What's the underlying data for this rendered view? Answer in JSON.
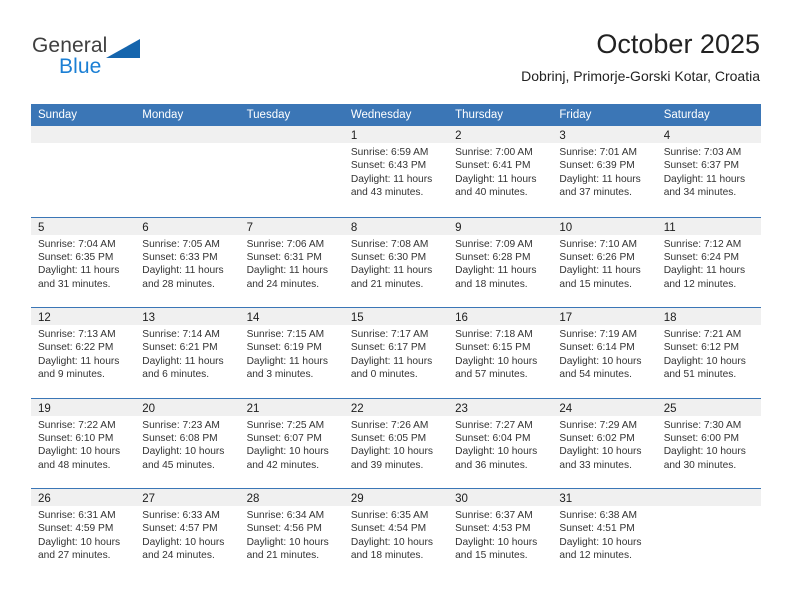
{
  "brand": {
    "name_part1": "General",
    "name_part2": "Blue",
    "accent_color": "#1b7fd4",
    "triangle_color": "#1565ad"
  },
  "header": {
    "month_title": "October 2025",
    "location": "Dobrinj, Primorje-Gorski Kotar, Croatia"
  },
  "calendar": {
    "header_color": "#3b76b6",
    "day_band_color": "#f0f0f0",
    "weekdays": [
      "Sunday",
      "Monday",
      "Tuesday",
      "Wednesday",
      "Thursday",
      "Friday",
      "Saturday"
    ],
    "weeks": [
      [
        {
          "empty": true
        },
        {
          "empty": true
        },
        {
          "empty": true
        },
        {
          "day": "1",
          "sunrise": "Sunrise: 6:59 AM",
          "sunset": "Sunset: 6:43 PM",
          "daylight1": "Daylight: 11 hours",
          "daylight2": "and 43 minutes."
        },
        {
          "day": "2",
          "sunrise": "Sunrise: 7:00 AM",
          "sunset": "Sunset: 6:41 PM",
          "daylight1": "Daylight: 11 hours",
          "daylight2": "and 40 minutes."
        },
        {
          "day": "3",
          "sunrise": "Sunrise: 7:01 AM",
          "sunset": "Sunset: 6:39 PM",
          "daylight1": "Daylight: 11 hours",
          "daylight2": "and 37 minutes."
        },
        {
          "day": "4",
          "sunrise": "Sunrise: 7:03 AM",
          "sunset": "Sunset: 6:37 PM",
          "daylight1": "Daylight: 11 hours",
          "daylight2": "and 34 minutes."
        }
      ],
      [
        {
          "day": "5",
          "sunrise": "Sunrise: 7:04 AM",
          "sunset": "Sunset: 6:35 PM",
          "daylight1": "Daylight: 11 hours",
          "daylight2": "and 31 minutes."
        },
        {
          "day": "6",
          "sunrise": "Sunrise: 7:05 AM",
          "sunset": "Sunset: 6:33 PM",
          "daylight1": "Daylight: 11 hours",
          "daylight2": "and 28 minutes."
        },
        {
          "day": "7",
          "sunrise": "Sunrise: 7:06 AM",
          "sunset": "Sunset: 6:31 PM",
          "daylight1": "Daylight: 11 hours",
          "daylight2": "and 24 minutes."
        },
        {
          "day": "8",
          "sunrise": "Sunrise: 7:08 AM",
          "sunset": "Sunset: 6:30 PM",
          "daylight1": "Daylight: 11 hours",
          "daylight2": "and 21 minutes."
        },
        {
          "day": "9",
          "sunrise": "Sunrise: 7:09 AM",
          "sunset": "Sunset: 6:28 PM",
          "daylight1": "Daylight: 11 hours",
          "daylight2": "and 18 minutes."
        },
        {
          "day": "10",
          "sunrise": "Sunrise: 7:10 AM",
          "sunset": "Sunset: 6:26 PM",
          "daylight1": "Daylight: 11 hours",
          "daylight2": "and 15 minutes."
        },
        {
          "day": "11",
          "sunrise": "Sunrise: 7:12 AM",
          "sunset": "Sunset: 6:24 PM",
          "daylight1": "Daylight: 11 hours",
          "daylight2": "and 12 minutes."
        }
      ],
      [
        {
          "day": "12",
          "sunrise": "Sunrise: 7:13 AM",
          "sunset": "Sunset: 6:22 PM",
          "daylight1": "Daylight: 11 hours",
          "daylight2": "and 9 minutes."
        },
        {
          "day": "13",
          "sunrise": "Sunrise: 7:14 AM",
          "sunset": "Sunset: 6:21 PM",
          "daylight1": "Daylight: 11 hours",
          "daylight2": "and 6 minutes."
        },
        {
          "day": "14",
          "sunrise": "Sunrise: 7:15 AM",
          "sunset": "Sunset: 6:19 PM",
          "daylight1": "Daylight: 11 hours",
          "daylight2": "and 3 minutes."
        },
        {
          "day": "15",
          "sunrise": "Sunrise: 7:17 AM",
          "sunset": "Sunset: 6:17 PM",
          "daylight1": "Daylight: 11 hours",
          "daylight2": "and 0 minutes."
        },
        {
          "day": "16",
          "sunrise": "Sunrise: 7:18 AM",
          "sunset": "Sunset: 6:15 PM",
          "daylight1": "Daylight: 10 hours",
          "daylight2": "and 57 minutes."
        },
        {
          "day": "17",
          "sunrise": "Sunrise: 7:19 AM",
          "sunset": "Sunset: 6:14 PM",
          "daylight1": "Daylight: 10 hours",
          "daylight2": "and 54 minutes."
        },
        {
          "day": "18",
          "sunrise": "Sunrise: 7:21 AM",
          "sunset": "Sunset: 6:12 PM",
          "daylight1": "Daylight: 10 hours",
          "daylight2": "and 51 minutes."
        }
      ],
      [
        {
          "day": "19",
          "sunrise": "Sunrise: 7:22 AM",
          "sunset": "Sunset: 6:10 PM",
          "daylight1": "Daylight: 10 hours",
          "daylight2": "and 48 minutes."
        },
        {
          "day": "20",
          "sunrise": "Sunrise: 7:23 AM",
          "sunset": "Sunset: 6:08 PM",
          "daylight1": "Daylight: 10 hours",
          "daylight2": "and 45 minutes."
        },
        {
          "day": "21",
          "sunrise": "Sunrise: 7:25 AM",
          "sunset": "Sunset: 6:07 PM",
          "daylight1": "Daylight: 10 hours",
          "daylight2": "and 42 minutes."
        },
        {
          "day": "22",
          "sunrise": "Sunrise: 7:26 AM",
          "sunset": "Sunset: 6:05 PM",
          "daylight1": "Daylight: 10 hours",
          "daylight2": "and 39 minutes."
        },
        {
          "day": "23",
          "sunrise": "Sunrise: 7:27 AM",
          "sunset": "Sunset: 6:04 PM",
          "daylight1": "Daylight: 10 hours",
          "daylight2": "and 36 minutes."
        },
        {
          "day": "24",
          "sunrise": "Sunrise: 7:29 AM",
          "sunset": "Sunset: 6:02 PM",
          "daylight1": "Daylight: 10 hours",
          "daylight2": "and 33 minutes."
        },
        {
          "day": "25",
          "sunrise": "Sunrise: 7:30 AM",
          "sunset": "Sunset: 6:00 PM",
          "daylight1": "Daylight: 10 hours",
          "daylight2": "and 30 minutes."
        }
      ],
      [
        {
          "day": "26",
          "sunrise": "Sunrise: 6:31 AM",
          "sunset": "Sunset: 4:59 PM",
          "daylight1": "Daylight: 10 hours",
          "daylight2": "and 27 minutes."
        },
        {
          "day": "27",
          "sunrise": "Sunrise: 6:33 AM",
          "sunset": "Sunset: 4:57 PM",
          "daylight1": "Daylight: 10 hours",
          "daylight2": "and 24 minutes."
        },
        {
          "day": "28",
          "sunrise": "Sunrise: 6:34 AM",
          "sunset": "Sunset: 4:56 PM",
          "daylight1": "Daylight: 10 hours",
          "daylight2": "and 21 minutes."
        },
        {
          "day": "29",
          "sunrise": "Sunrise: 6:35 AM",
          "sunset": "Sunset: 4:54 PM",
          "daylight1": "Daylight: 10 hours",
          "daylight2": "and 18 minutes."
        },
        {
          "day": "30",
          "sunrise": "Sunrise: 6:37 AM",
          "sunset": "Sunset: 4:53 PM",
          "daylight1": "Daylight: 10 hours",
          "daylight2": "and 15 minutes."
        },
        {
          "day": "31",
          "sunrise": "Sunrise: 6:38 AM",
          "sunset": "Sunset: 4:51 PM",
          "daylight1": "Daylight: 10 hours",
          "daylight2": "and 12 minutes."
        },
        {
          "empty": true
        }
      ]
    ]
  }
}
